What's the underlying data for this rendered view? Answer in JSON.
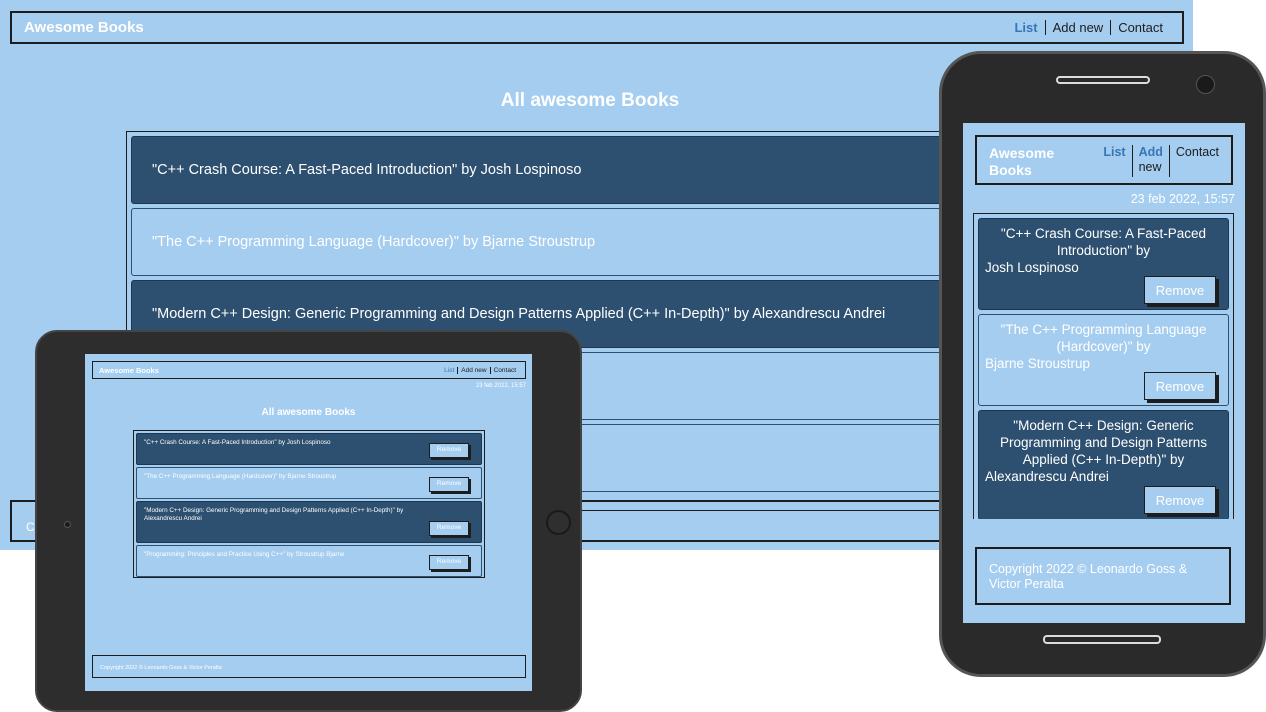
{
  "app": {
    "logo": "Awesome Books",
    "nav": [
      "List",
      "Add new",
      "Contact"
    ],
    "date": "23 feb 2022, 15:57",
    "page_title": "All awesome Books",
    "remove_label": "Remove",
    "footer": "Copyright 2022 © Leonardo Goss & Victor Peralta"
  },
  "desktop": {
    "footer_visible": "Co",
    "books": [
      "\"C++ Crash Course: A Fast-Paced Introduction\" by Josh Lospinoso",
      "\"The C++ Programming Language (Hardcover)\" by Bjarne Stroustrup",
      "\"Modern C++ Design: Generic Programming and Design Patterns Applied (C++ In-Depth)\" by Alexandrescu Andrei"
    ]
  },
  "tablet": {
    "books": [
      "\"C++ Crash Course: A Fast-Paced Introduction\" by Josh Lospinoso",
      "\"The C++ Programming Language (Hardcover)\" by Bjarne Stroustrup",
      "\"Modern C++ Design: Generic Programming and Design Patterns Applied (C++ In-Depth)\" by Alexandrescu Andrei",
      "\"Programming: Principles and Practice Using C++\" by Stroustrup Bjarne"
    ]
  },
  "phone": {
    "logo_line1": "Awesome",
    "logo_line2": "Books",
    "nav_add_line1": "Add",
    "nav_add_line2": "new",
    "books": [
      {
        "title": "\"C++ Crash Course: A Fast-Paced Introduction\" by",
        "author": "Josh Lospinoso"
      },
      {
        "title": "\"The C++ Programming Language (Hardcover)\" by",
        "author": "Bjarne Stroustrup"
      },
      {
        "title": "\"Modern C++ Design: Generic Programming and Design Patterns Applied (C++ In-Depth)\" by",
        "author": "Alexandrescu Andrei"
      }
    ],
    "footer_line1": "Copyright 2022 © Leonardo Goss &",
    "footer_line2": "Victor Peralta"
  },
  "colors": {
    "background": "#a5cdf0",
    "card_dark": "#2d5070",
    "nav_active": "#3876b8",
    "border": "#1d1d1d"
  },
  "icons": [
    "tablet-camera-icon",
    "tablet-home-button-icon",
    "phone-speaker-icon",
    "phone-camera-icon"
  ]
}
